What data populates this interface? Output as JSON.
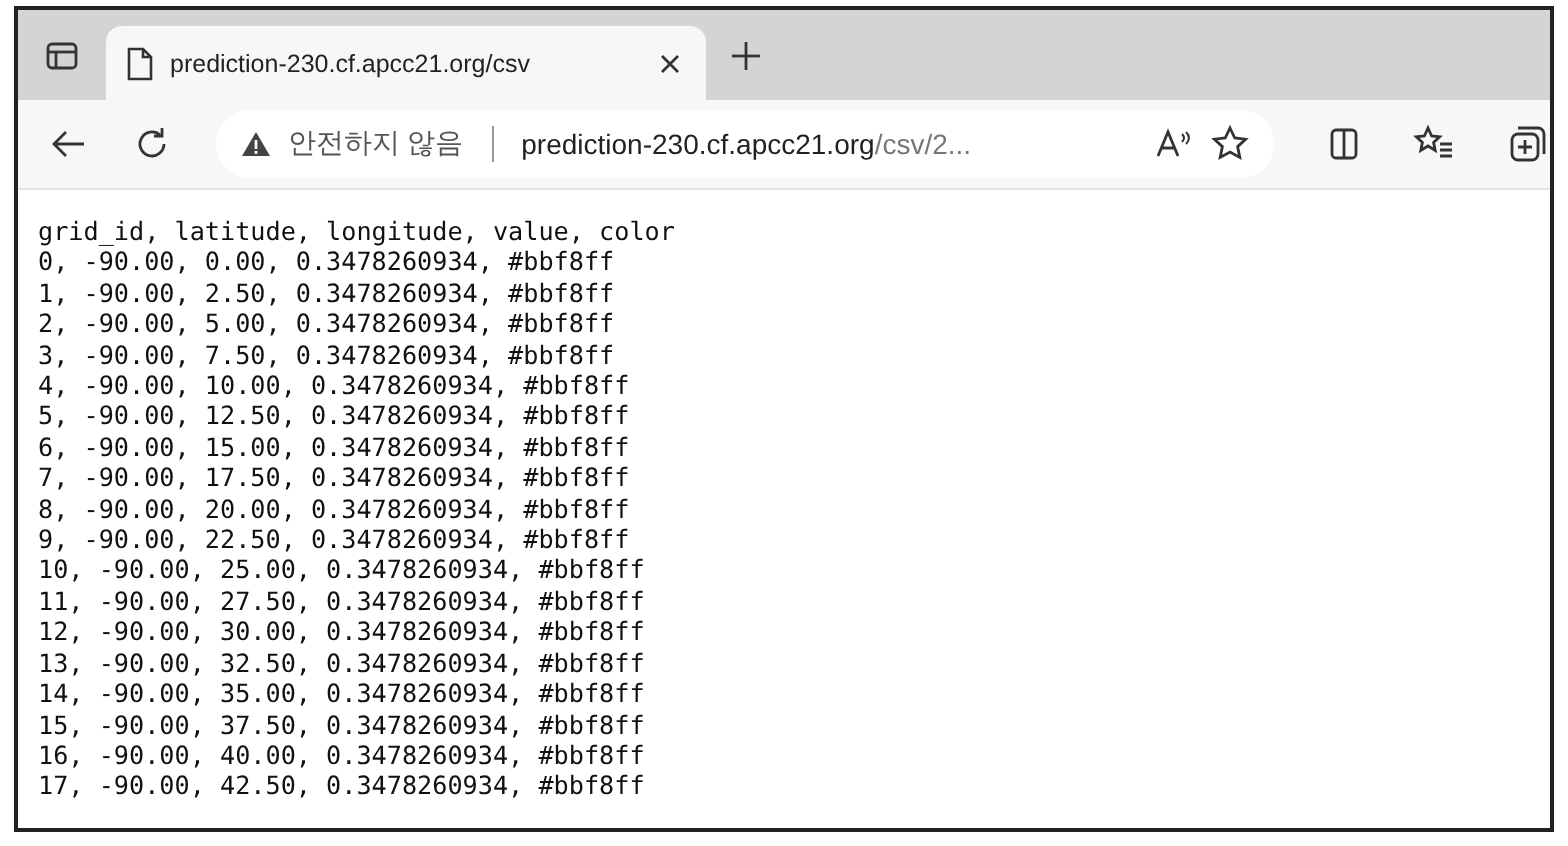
{
  "tab_bar": {
    "tabs": [
      {
        "title": "prediction-230.cf.apcc21.org/csv",
        "selected": true
      }
    ]
  },
  "toolbar": {
    "security_label": "안전하지 않음",
    "url_host": "prediction-230.cf.apcc21.org",
    "url_path": "/csv/2..."
  },
  "content": {
    "lines": [
      "grid_id, latitude, longitude, value, color",
      "0, -90.00, 0.00, 0.3478260934, #bbf8ff",
      "1, -90.00, 2.50, 0.3478260934, #bbf8ff",
      "2, -90.00, 5.00, 0.3478260934, #bbf8ff",
      "3, -90.00, 7.50, 0.3478260934, #bbf8ff",
      "4, -90.00, 10.00, 0.3478260934, #bbf8ff",
      "5, -90.00, 12.50, 0.3478260934, #bbf8ff",
      "6, -90.00, 15.00, 0.3478260934, #bbf8ff",
      "7, -90.00, 17.50, 0.3478260934, #bbf8ff",
      "8, -90.00, 20.00, 0.3478260934, #bbf8ff",
      "9, -90.00, 22.50, 0.3478260934, #bbf8ff",
      "10, -90.00, 25.00, 0.3478260934, #bbf8ff",
      "11, -90.00, 27.50, 0.3478260934, #bbf8ff",
      "12, -90.00, 30.00, 0.3478260934, #bbf8ff",
      "13, -90.00, 32.50, 0.3478260934, #bbf8ff",
      "14, -90.00, 35.00, 0.3478260934, #bbf8ff",
      "15, -90.00, 37.50, 0.3478260934, #bbf8ff",
      "16, -90.00, 40.00, 0.3478260934, #bbf8ff",
      "17, -90.00, 42.50, 0.3478260934, #bbf8ff"
    ]
  }
}
